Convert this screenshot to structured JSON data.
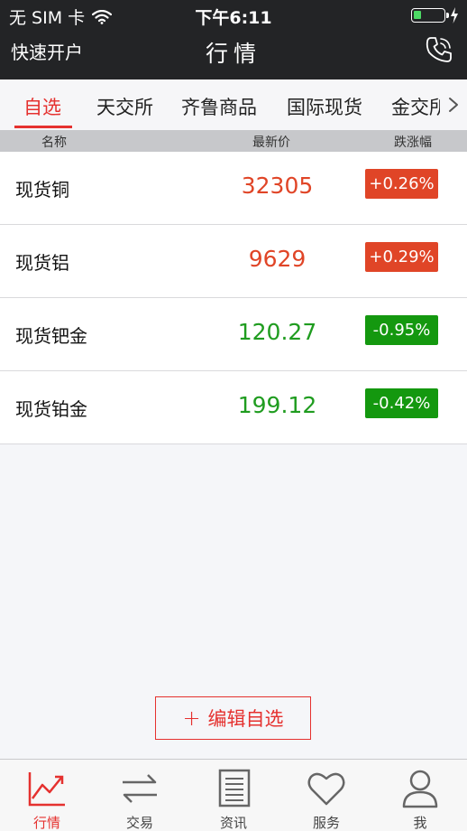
{
  "status_bar": {
    "carrier": "无 SIM 卡",
    "time": "下午6:11",
    "battery_level": 0.25
  },
  "nav": {
    "left_label": "快速开户",
    "title": "行情"
  },
  "tabs": [
    {
      "label": "自选",
      "active": true
    },
    {
      "label": "天交所",
      "active": false
    },
    {
      "label": "齐鲁商品",
      "active": false
    },
    {
      "label": "国际现货",
      "active": false
    },
    {
      "label": "金交所",
      "active": false
    }
  ],
  "columns": {
    "name": "名称",
    "price": "最新价",
    "change": "跌涨幅"
  },
  "rows": [
    {
      "name": "现货铜",
      "price": "32305",
      "change": "+0.26%",
      "trend": "up"
    },
    {
      "name": "现货铝",
      "price": "9629",
      "change": "+0.29%",
      "trend": "up"
    },
    {
      "name": "现货钯金",
      "price": "120.27",
      "change": "-0.95%",
      "trend": "down"
    },
    {
      "name": "现货铂金",
      "price": "199.12",
      "change": "-0.42%",
      "trend": "down"
    }
  ],
  "edit_button": {
    "plus": "+",
    "label": "编辑自选"
  },
  "tabbar": [
    {
      "label": "行情",
      "icon": "chart-line-icon",
      "active": true
    },
    {
      "label": "交易",
      "icon": "swap-arrows-icon",
      "active": false
    },
    {
      "label": "资讯",
      "icon": "document-icon",
      "active": false
    },
    {
      "label": "服务",
      "icon": "heart-icon",
      "active": false
    },
    {
      "label": "我",
      "icon": "person-icon",
      "active": false
    }
  ],
  "colors": {
    "accent": "#e5312f",
    "up": "#e04527",
    "down": "#14980f",
    "header_bg": "#232426"
  }
}
